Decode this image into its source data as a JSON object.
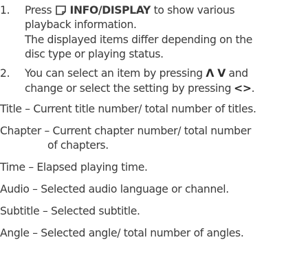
{
  "steps": [
    {
      "number": "1.",
      "press": "Press",
      "icon": "display-button-icon",
      "button_label": "INFO/DISPLAY",
      "after_button": "to show various",
      "line2": "playback information.",
      "line3": "The displayed items differ depending on the",
      "line4": "disc type or playing status."
    },
    {
      "number": "2.",
      "line1_text": "You can select an item by pressing",
      "updown_symbols": "Λ V",
      "line1_tail": "and",
      "line2_text": "change or select the setting by pressing",
      "leftright_symbols": "<>",
      "line2_tail": "."
    }
  ],
  "definitions": [
    {
      "line": "Title – Current title number/ total number of titles."
    },
    {
      "line": "Chapter – Current chapter number/ total number",
      "cont": "of chapters."
    },
    {
      "line": "Time – Elapsed playing time."
    },
    {
      "line": "Audio – Selected audio language or channel."
    },
    {
      "line": "Subtitle – Selected subtitle."
    },
    {
      "line": "Angle – Selected angle/ total number of angles."
    }
  ]
}
